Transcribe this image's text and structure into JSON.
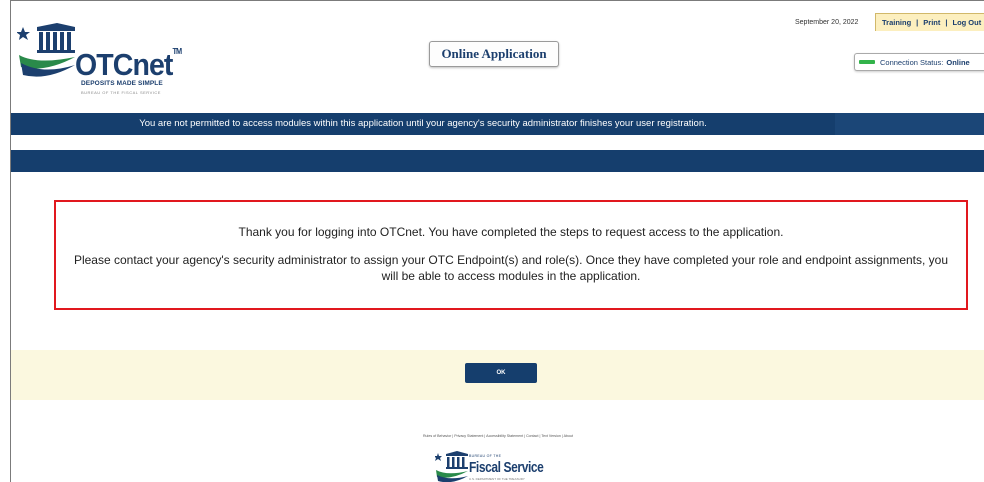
{
  "header": {
    "logo": {
      "name": "OTCnet",
      "tm": "TM",
      "tagline": "DEPOSITS MADE SIMPLE",
      "subline": "BUREAU OF THE FISCAL SERVICE"
    },
    "app_title": "Online Application",
    "date": "September 20, 2022",
    "links": {
      "training": "Training",
      "print": "Print",
      "logout": "Log Out"
    },
    "connection": {
      "label": "Connection Status:",
      "value": "Online",
      "color": "#32b34a"
    }
  },
  "banner": {
    "message": "You are not permitted to access modules within this application until your agency's security administrator finishes your user registration."
  },
  "message_box": {
    "line1": "Thank you for logging into OTCnet. You have completed the steps to request access to the application.",
    "line2": "Please contact your agency's security administrator to assign your OTC Endpoint(s) and role(s). Once they have completed your role and endpoint assignments, you will be able to access modules in the application."
  },
  "actions": {
    "ok_label": "OK"
  },
  "footer": {
    "links": [
      "Rules of Behavior",
      "Privacy Statement",
      "Accessibility Statement",
      "Contact",
      "Text Version",
      "About"
    ],
    "logo": {
      "small": "BUREAU OF THE",
      "big": "Fiscal Service",
      "tiny": "U.S. DEPARTMENT OF THE TREASURY"
    }
  },
  "colors": {
    "navy": "#153e6d",
    "alert_border": "#e1181e",
    "action_bar_bg": "#fbf8df",
    "links_bg": "#fcefbf"
  }
}
